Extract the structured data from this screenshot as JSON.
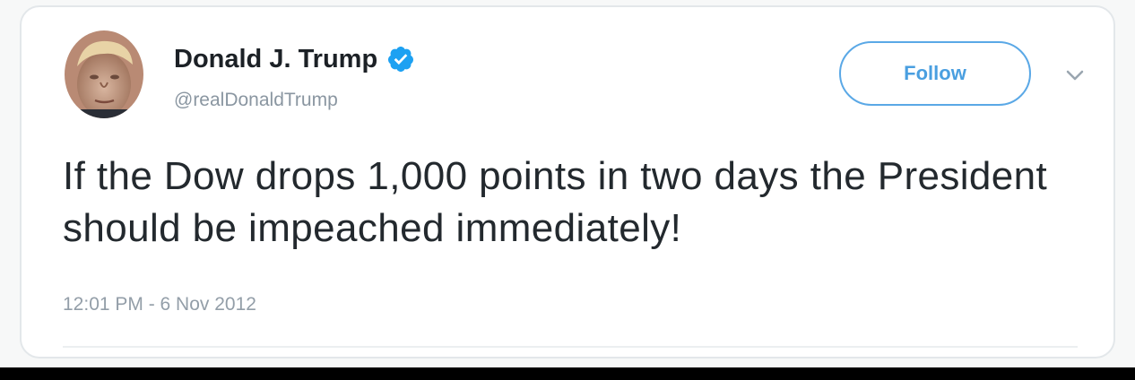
{
  "tweet": {
    "display_name": "Donald J. Trump",
    "handle": "@realDonaldTrump",
    "verified": true,
    "follow_label": "Follow",
    "text": "If the Dow drops 1,000 points in two days the President should be impeached immediately!",
    "timestamp": "12:01 PM - 6 Nov 2012"
  },
  "icons": {
    "verified": "verified-badge-icon",
    "menu": "chevron-down-icon"
  },
  "colors": {
    "accent": "#1da1f2",
    "follow_border": "#5aa8e6",
    "name": "#1c2126",
    "muted": "#8a96a1",
    "body_text": "#23292e"
  }
}
